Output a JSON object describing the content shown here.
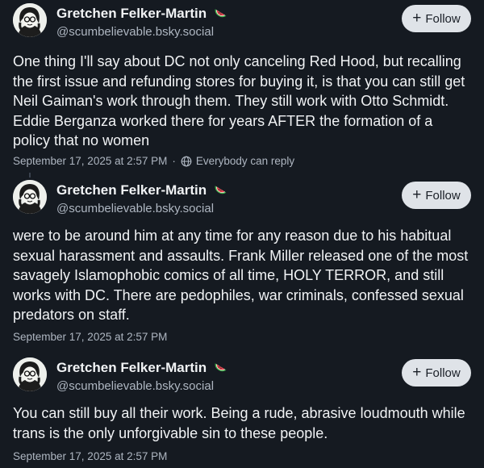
{
  "posts": [
    {
      "author": "Gretchen Felker-Martin",
      "handle": "@scumbelievable.bsky.social",
      "follow_label": "Follow",
      "text": "One thing I'll say about DC not only canceling Red Hood, but recalling the first issue and refunding stores for buying it, is that you can still get Neil Gaiman's work through them. They still work with Otto Schmidt. Eddie Berganza worked there for years AFTER the formation of a policy that no women",
      "timestamp": "September 17, 2025 at 2:57 PM",
      "reply_setting": "Everybody can reply"
    },
    {
      "author": "Gretchen Felker-Martin",
      "handle": "@scumbelievable.bsky.social",
      "follow_label": "Follow",
      "text": "were to be around him at any time for any reason due to his habitual sexual harassment and assaults. Frank Miller released one of the most savagely Islamophobic comics of all time, HOLY TERROR, and still works with DC. There are pedophiles, war criminals, confessed sexual predators on staff.",
      "timestamp": "September 17, 2025 at 2:57 PM"
    },
    {
      "author": "Gretchen Felker-Martin",
      "handle": "@scumbelievable.bsky.social",
      "follow_label": "Follow",
      "text": "You can still buy all their work. Being a rude, abrasive loudmouth while trans is the only unforgivable sin to these people.",
      "timestamp": "September 17, 2025 at 2:57 PM"
    }
  ],
  "icons": {
    "name_emoji": "watermelon-icon",
    "reply_setting": "globe-icon",
    "follow": "plus-icon"
  }
}
